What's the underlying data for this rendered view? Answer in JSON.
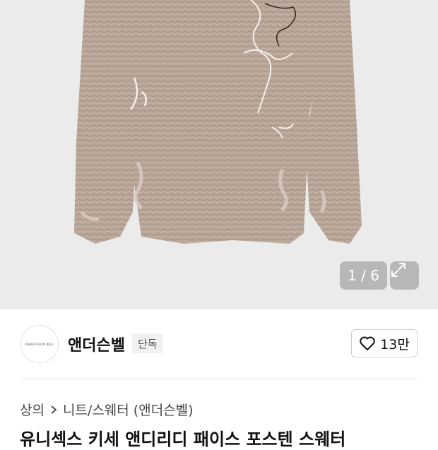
{
  "gallery": {
    "counter": "1 / 6"
  },
  "brand": {
    "logo_text": "ANDERSSON BELL",
    "name": "앤더슨벨",
    "badge": "단독",
    "likes": "13만"
  },
  "breadcrumb": {
    "items": [
      "상의",
      "니트/스웨터 (앤더슨벨)"
    ]
  },
  "product": {
    "title": "유니섹스 키세 앤디리디 패이스 포스텐 스웨터"
  },
  "colors": {
    "knit": "#b7a597",
    "hero_bg": "#ebebeb"
  },
  "icons": [
    "expand-icon",
    "heart-icon",
    "chevron-right-icon"
  ]
}
